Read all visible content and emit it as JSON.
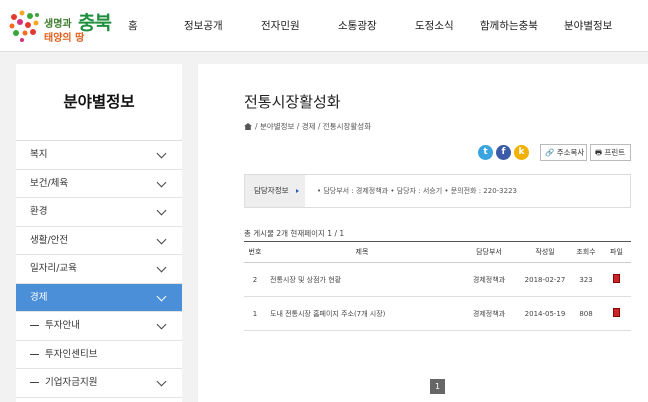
{
  "logo": {
    "line1a": "생명과",
    "line2": "태양의 땅",
    "big": "충북"
  },
  "nav": [
    "홈",
    "정보공개",
    "전자민원",
    "소통광장",
    "도정소식",
    "함께하는충북",
    "분야별정보"
  ],
  "sidebar": {
    "title": "분야별정보",
    "items": [
      {
        "label": "복지"
      },
      {
        "label": "보건/체육"
      },
      {
        "label": "환경"
      },
      {
        "label": "생활/안전"
      },
      {
        "label": "일자리/교육"
      },
      {
        "label": "경제"
      }
    ],
    "subitems": [
      {
        "label": "투자안내"
      },
      {
        "label": "투자인센티브"
      },
      {
        "label": "기업자금지원"
      }
    ]
  },
  "page": {
    "title": "전통시장활성화",
    "breadcrumb": "/ 분야별정보 / 경제 / 전통시장활성화",
    "copy_url": "주소복사",
    "print": "프린트",
    "info_label": "담당자정보",
    "info_text": "• 담당부서 : 경제정책과   • 담당자 : 서승기   • 문의전화 : 220-3223",
    "count_text": "총 게시물 2개 현재페이지 1 / 1",
    "columns": [
      "번호",
      "제목",
      "담당부서",
      "작성일",
      "조회수",
      "파일"
    ],
    "rows": [
      {
        "no": "2",
        "title": "전통시장 및 상점가 현황",
        "dept": "경제정책과",
        "date": "2018-02-27",
        "views": "323"
      },
      {
        "no": "1",
        "title": "도내 전통시장 홈페이지 주소(7개 시장)",
        "dept": "경제정책과",
        "date": "2014-05-19",
        "views": "808"
      }
    ],
    "current_page": "1"
  },
  "colors": {
    "accent": "#4a8fd8",
    "twitter": "#3aa4e0",
    "facebook": "#3b5ba8",
    "kakao": "#f0b100",
    "pdf": "#c8262c"
  }
}
